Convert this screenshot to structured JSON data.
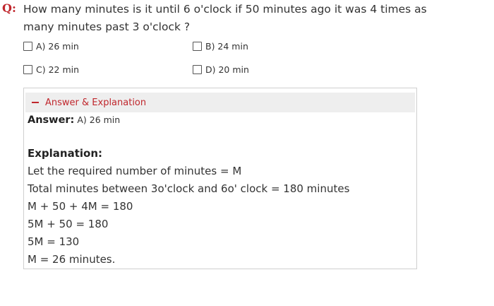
{
  "question": {
    "label": "Q:",
    "text": "How many minutes is it until 6 o'clock if 50 minutes ago it was 4 times as many minutes past 3 o'clock ?"
  },
  "options": [
    {
      "label": "A) 26 min"
    },
    {
      "label": "B) 24 min"
    },
    {
      "label": "C) 22 min"
    },
    {
      "label": "D) 20 min"
    }
  ],
  "panel": {
    "toggle_label": "Answer & Explanation",
    "answer_heading": "Answer:",
    "answer_value": "A) 26 min",
    "explanation_heading": "Explanation:",
    "lines": [
      "Let the required number of minutes = M",
      "Total minutes between 3o'clock and 6o' clock = 180 minutes",
      "M + 50 + 4M = 180",
      "5M + 50 = 180",
      "5M = 130",
      "M = 26 minutes."
    ]
  },
  "colors": {
    "accent": "#c0272d",
    "panel_border": "#cfcfcf",
    "toggle_bg": "#eeeeee"
  }
}
